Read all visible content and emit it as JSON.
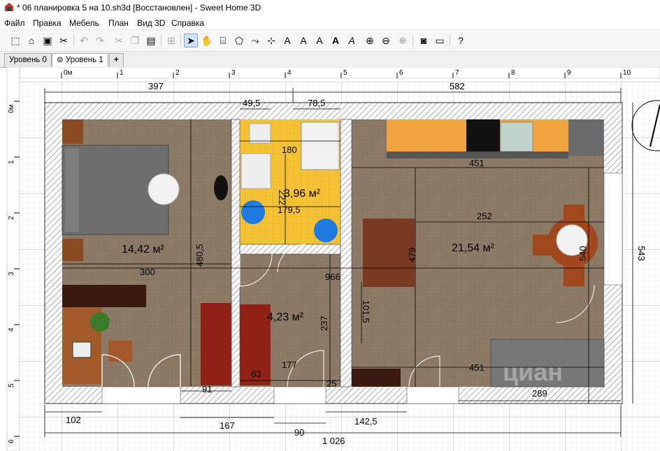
{
  "window": {
    "title": "* 06 планировка 5 на 10.sh3d [Восстановлен] - Sweet Home 3D",
    "icon": "sweet-home-3d-icon"
  },
  "menu": [
    "Файл",
    "Правка",
    "Мебель",
    "План",
    "Вид 3D",
    "Справка"
  ],
  "toolbar": [
    {
      "icon": "new-home-icon"
    },
    {
      "icon": "open-icon"
    },
    {
      "icon": "save-icon"
    },
    {
      "icon": "cut-tool-icon"
    },
    {
      "icon": "undo-icon",
      "disabled": true
    },
    {
      "icon": "redo-icon",
      "disabled": true
    },
    {
      "icon": "cut-icon",
      "disabled": true
    },
    {
      "icon": "copy-icon",
      "disabled": true
    },
    {
      "icon": "paste-icon"
    },
    {
      "icon": "add-furniture-icon",
      "disabled": true
    },
    {
      "icon": "select-mode-icon",
      "selected": true
    },
    {
      "icon": "pan-mode-icon"
    },
    {
      "icon": "create-walls-icon"
    },
    {
      "icon": "create-rooms-icon"
    },
    {
      "icon": "create-polylines-icon"
    },
    {
      "icon": "create-dimensions-icon"
    },
    {
      "icon": "add-text-icon"
    },
    {
      "icon": "increase-text-size-icon"
    },
    {
      "icon": "decrease-text-size-icon"
    },
    {
      "icon": "bold-text-icon"
    },
    {
      "icon": "italic-text-icon"
    },
    {
      "icon": "zoom-in-icon"
    },
    {
      "icon": "zoom-out-icon"
    },
    {
      "icon": "create-photo-icon"
    },
    {
      "icon": "photo-icon"
    },
    {
      "icon": "video-icon"
    },
    {
      "icon": "help-icon"
    }
  ],
  "tabs": [
    {
      "label": "Уровень 0",
      "active": false
    },
    {
      "label": "Уровень 1",
      "active": true,
      "icon": "level-icon"
    },
    {
      "label": "+",
      "icon": "add-level-icon"
    }
  ],
  "plan": {
    "ruler_x": [
      "0м",
      "1",
      "2",
      "3",
      "4",
      "5",
      "6",
      "7",
      "8",
      "9",
      "10"
    ],
    "ruler_y": [
      "0м",
      "1",
      "2",
      "3",
      "4",
      "5",
      "6"
    ],
    "rooms": [
      {
        "area": "14,42 м²"
      },
      {
        "area": "3,96 м²"
      },
      {
        "area": "4,23 м²"
      },
      {
        "area": "21,54 м²"
      }
    ],
    "dimensions": {
      "top_left": "397",
      "top_right": "582",
      "bath_left": "49,5",
      "bath_right": "78,5",
      "bath_180": "180",
      "bath_222": "222",
      "bath_1795": "179,5",
      "kitchen_451_top": "451",
      "kitchen_252": "252",
      "kitchen_479": "479",
      "kitchen_540": "540",
      "bed_4805": "480,5",
      "bed_300": "300",
      "hall_966": "966",
      "hall_237": "237",
      "hall_1015": "101,5",
      "hall_63": "63",
      "hall_177": "177",
      "hall_25": "25",
      "bed_91": "91",
      "kitchen_451_bottom": "451",
      "kitchen_289": "289",
      "right_543": "543",
      "bottom_102": "102",
      "bottom_167": "167",
      "bottom_1425": "142,5",
      "bottom_90": "90",
      "total": "1 026"
    },
    "watermark": "циан"
  },
  "colors": {
    "floor_brown": "#8c7a66",
    "bath_yellow": "#f5c233",
    "wall_hatch": "#9a9a9a",
    "kitchen_orange": "#f0a440",
    "chair_brown": "#a0471e",
    "sofa_grey": "#777777",
    "bed_grey": "#6e6e6e",
    "door_red": "#8f2214"
  }
}
